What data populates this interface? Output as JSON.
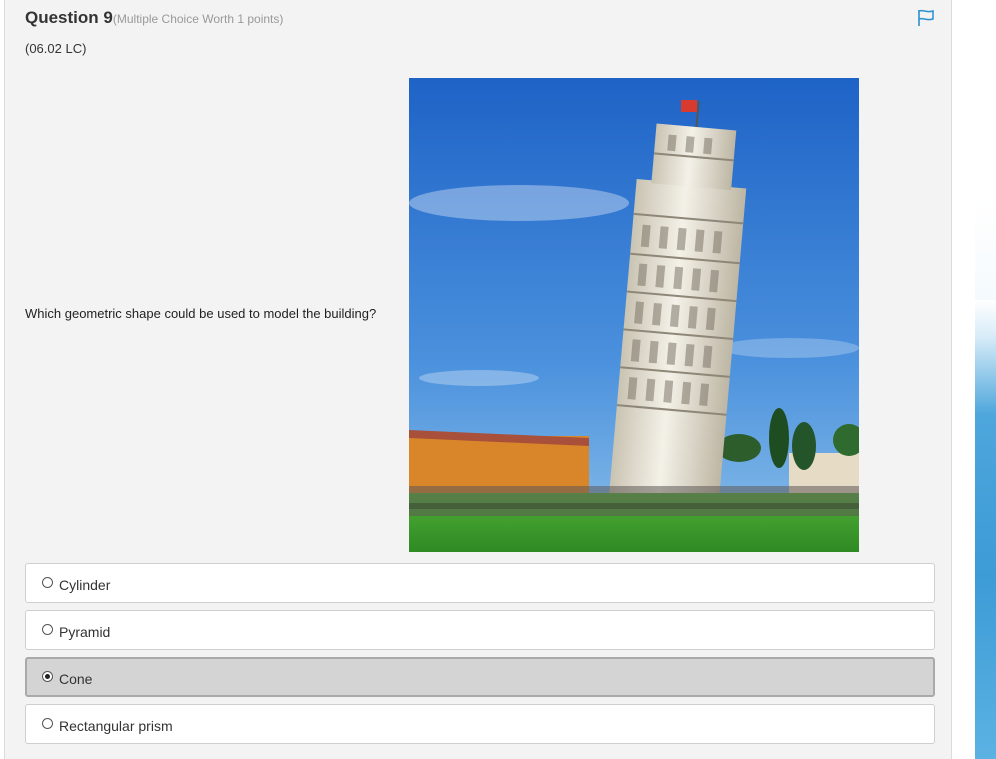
{
  "question": {
    "title": "Question 9",
    "meta": "(Multiple Choice Worth 1 points)",
    "code": "(06.02 LC)",
    "prompt": "Which geometric shape could be used to model the building?",
    "flag_icon": "flag-icon"
  },
  "image": {
    "subject": "leaning-tower-photo",
    "colors": {
      "sky": "#2f76d2",
      "grass": "#3d9a2c",
      "tower": "#ece8dc",
      "building": "#d9862b"
    }
  },
  "choices": [
    {
      "label": "Cylinder",
      "selected": false
    },
    {
      "label": "Pyramid",
      "selected": false
    },
    {
      "label": "Cone",
      "selected": true
    },
    {
      "label": "Rectangular prism",
      "selected": false
    }
  ],
  "colors": {
    "accent": "#2b8fd0",
    "selected_bg": "#d4d4d4"
  }
}
